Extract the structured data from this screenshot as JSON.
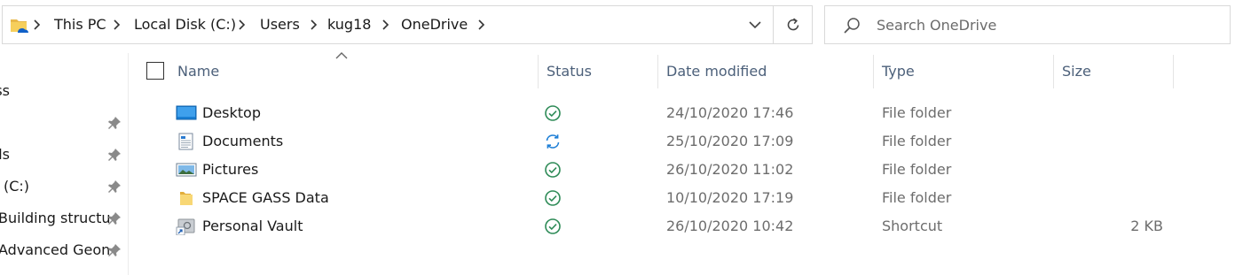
{
  "address": {
    "crumbs": [
      "This PC",
      "Local Disk (C:)",
      "Users",
      "kug18",
      "OneDrive"
    ],
    "dropdown_icon": "chevron-down-icon",
    "refresh_icon": "refresh-icon"
  },
  "search": {
    "placeholder": "Search OneDrive",
    "icon": "search-icon"
  },
  "nav": {
    "items": [
      {
        "label": "ss",
        "pinned": false
      },
      {
        "label": "",
        "pinned": true
      },
      {
        "label": "ds",
        "pinned": true
      },
      {
        "label": "(C:)",
        "pinned": true
      },
      {
        "label": "Building structu",
        "pinned": true
      },
      {
        "label": "Advanced Geon",
        "pinned": true
      }
    ]
  },
  "columns": {
    "name": "Name",
    "status": "Status",
    "date_modified": "Date modified",
    "type": "Type",
    "size": "Size"
  },
  "files": [
    {
      "name": "Desktop",
      "icon": "desktop-folder-icon",
      "status": "synced",
      "status_icon": "check-circle-icon",
      "date": "24/10/2020 17:46",
      "type": "File folder",
      "size": ""
    },
    {
      "name": "Documents",
      "icon": "documents-folder-icon",
      "status": "syncing",
      "status_icon": "sync-icon",
      "date": "25/10/2020 17:09",
      "type": "File folder",
      "size": ""
    },
    {
      "name": "Pictures",
      "icon": "pictures-folder-icon",
      "status": "synced",
      "status_icon": "check-circle-icon",
      "date": "26/10/2020 11:02",
      "type": "File folder",
      "size": ""
    },
    {
      "name": "SPACE GASS Data",
      "icon": "folder-icon",
      "status": "synced",
      "status_icon": "check-circle-icon",
      "date": "10/10/2020 17:19",
      "type": "File folder",
      "size": ""
    },
    {
      "name": "Personal Vault",
      "icon": "vault-shortcut-icon",
      "status": "synced",
      "status_icon": "check-circle-icon",
      "date": "26/10/2020 10:42",
      "type": "Shortcut",
      "size": "2 KB"
    }
  ],
  "colors": {
    "synced": "#2e8b57",
    "syncing": "#1e7fd6",
    "header_text": "#4c607a",
    "secondary_text": "#6d6d6d"
  }
}
